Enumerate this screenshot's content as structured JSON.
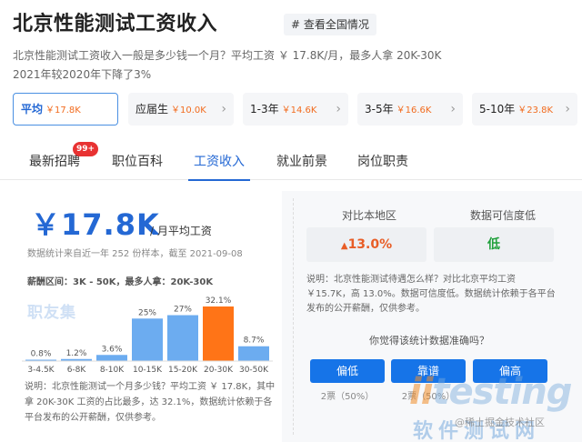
{
  "header": {
    "title": "北京性能测试工资收入",
    "view_all": "# 查看全国情况",
    "desc_line1": "北京性能测试工资收入一般是多少钱一个月？平均工资 ￥ 17.8K/月，最多人拿 20K-30K",
    "desc_line2": "2021年较2020年下降了3%"
  },
  "chips": [
    {
      "label": "平均",
      "amount": "￥17.8K",
      "active": true
    },
    {
      "label": "应届生",
      "amount": "￥10.0K",
      "arrow": "›"
    },
    {
      "label": "1-3年",
      "amount": "￥14.6K",
      "arrow": "›"
    },
    {
      "label": "3-5年",
      "amount": "￥16.6K",
      "arrow": "›"
    },
    {
      "label": "5-10年",
      "amount": "￥23.8K",
      "arrow": "›"
    }
  ],
  "tabs": [
    {
      "label": "最新招聘",
      "badge": "99+"
    },
    {
      "label": "职位百科"
    },
    {
      "label": "工资收入",
      "active": true
    },
    {
      "label": "就业前景"
    },
    {
      "label": "岗位职责"
    }
  ],
  "salary": {
    "average": "￥17.8K",
    "unit": "/ 月平均工资",
    "stat_note": "数据统计来自近一年 252 份样本，截至 2021-09-08",
    "range_label": "薪酬区间：",
    "range_value": "3K - 50K，最多人拿：20K-30K",
    "watermark": "职友集",
    "note": "说明：北京性能测试一个月多少钱？平均工资 ￥ 17.8K，其中拿 20K-30K 工资的占比最多，达 32.1%，数据统计依赖于各平台发布的公开薪酬，仅供参考。"
  },
  "chart_data": {
    "type": "bar",
    "categories": [
      "3-4.5K",
      "6-8K",
      "8-10K",
      "10-15K",
      "15-20K",
      "20-30K",
      "30-50K"
    ],
    "values": [
      0.8,
      1.2,
      3.6,
      25,
      27,
      32.1,
      8.7
    ],
    "value_labels": [
      "0.8%",
      "1.2%",
      "3.6%",
      "25%",
      "27%",
      "32.1%",
      "8.7%"
    ],
    "highlight_index": 5,
    "colors": {
      "bar": "#6cacf0",
      "highlight": "#ff7417"
    },
    "ylim": [
      0,
      32.1
    ]
  },
  "compare": {
    "local_label": "对比本地区",
    "local_value": "13.0%",
    "local_arrow": "▲",
    "credibility_label": "数据可信度低",
    "credibility_value": "低",
    "note": "说明：北京性能测试待遇怎么样？对比北京平均工资 ￥15.7K，高 13.0%。数据可信度低。数据统计依赖于各平台发布的公开薪酬，仅供参考。",
    "question": "你觉得该统计数据准确吗？"
  },
  "votes": [
    {
      "label": "偏低",
      "count": "2票（50%）"
    },
    {
      "label": "靠谱",
      "count": "2票（50%）"
    },
    {
      "label": "偏高",
      "count": ""
    }
  ],
  "watermarks": {
    "brand": "testing",
    "brand_prefix": "ii",
    "cn": "软件测试网",
    "source": "@稀土掘金技术社区"
  },
  "colors": {
    "accent": "#2468d4",
    "orange": "#f26c1f",
    "button": "#1674e8"
  }
}
